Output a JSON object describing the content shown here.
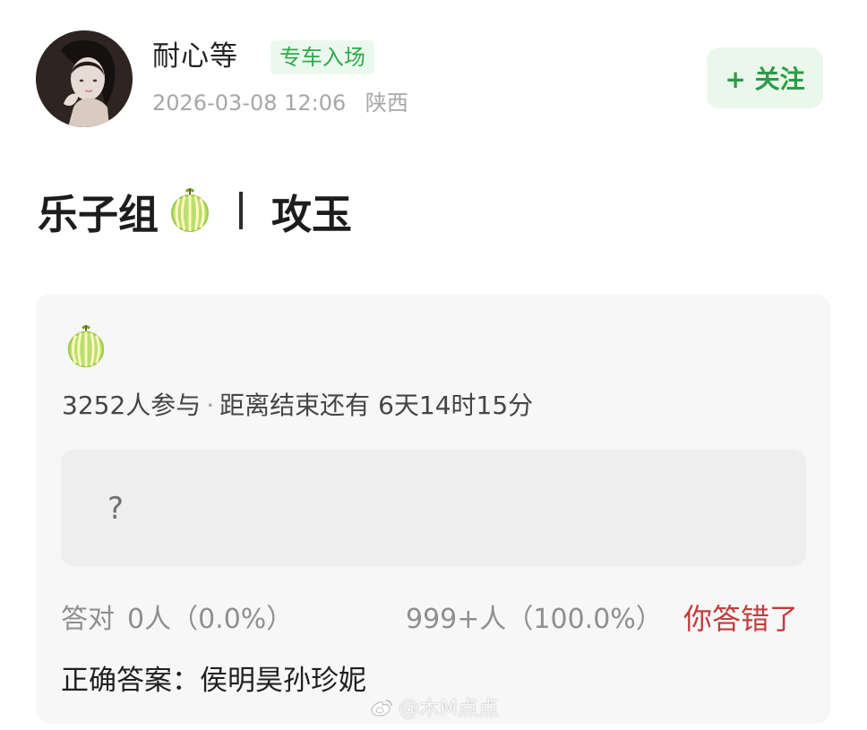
{
  "profile": {
    "name": "耐心等",
    "badge": "专车入场",
    "timestamp": "2026-03-08 12:06",
    "region": "陕西",
    "follow_label": "+ 关注",
    "avatar_icon": "woman-avatar-icon"
  },
  "post": {
    "title_left": "乐子组",
    "title_right": "攻玉",
    "title_icon": "melon-icon"
  },
  "poll": {
    "participants": "3252人参与",
    "deadline": "距离结束还有 6天14时15分",
    "option_text": "?",
    "correct_label": "答对",
    "correct_count": "0人（0.0%）",
    "other_count": "999+人（100.0%）",
    "wrong_tag": "你答错了",
    "answer": "正确答案：侯明昊孙珍妮",
    "poll_icon": "melon-icon"
  },
  "watermark": {
    "text": "@木M点点",
    "icon": "weibo-icon"
  },
  "colors": {
    "badge_green": "#2faa4b",
    "follow_bg": "#eaf8ec",
    "card_bg": "#f7f7f7",
    "option_bg": "#eeeeee",
    "wrong_red": "#c13e3e"
  }
}
